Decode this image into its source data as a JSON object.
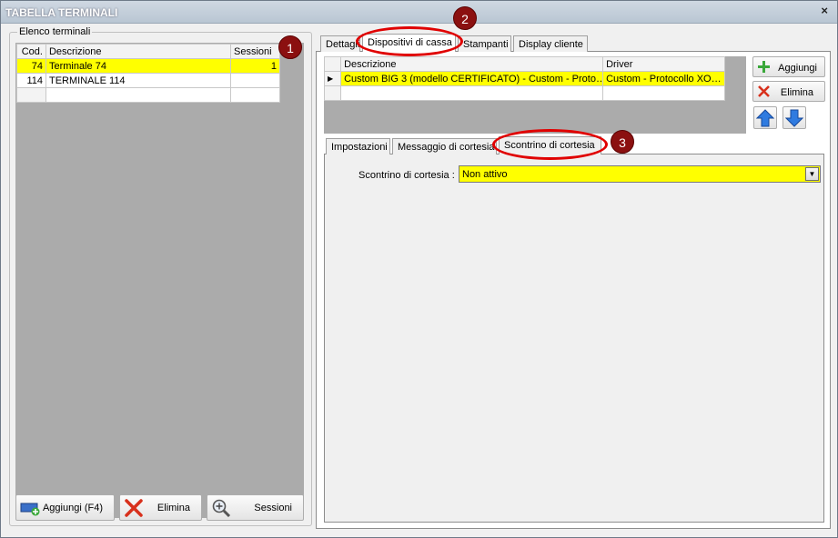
{
  "window": {
    "title": "TABELLA TERMINALI",
    "close_glyph": "×"
  },
  "left": {
    "group_label": "Elenco terminali",
    "columns": [
      "Cod.",
      "Descrizione",
      "Sessioni"
    ],
    "rows": [
      {
        "cod": "74",
        "descrizione": "Terminale 74",
        "sessioni": "1"
      },
      {
        "cod": "114",
        "descrizione": "TERMINALE 114",
        "sessioni": ""
      }
    ],
    "buttons": {
      "add": "Aggiungi (F4)",
      "delete": "Elimina",
      "sessions": "Sessioni"
    }
  },
  "tabs_top": [
    "Dettagli",
    "Dispositivi di cassa",
    "Stampanti",
    "Display cliente"
  ],
  "devices": {
    "columns": [
      "Descrizione",
      "Driver"
    ],
    "rows": [
      {
        "descrizione": "Custom BIG 3 (modello CERTIFICATO) - Custom - Proto…",
        "driver": "Custom - Protocollo XO…"
      }
    ],
    "buttons": {
      "add": "Aggiungi",
      "delete": "Elimina"
    }
  },
  "tabs_sub": [
    "Impostazioni",
    "Messaggio di cortesia",
    "Scontrino di cortesia"
  ],
  "form": {
    "label": "Scontrino di cortesia :",
    "value": "Non attivo"
  },
  "badges": [
    "1",
    "2",
    "3"
  ],
  "colors": {
    "highlight": "#ffff00",
    "annotation_ring": "#e00000",
    "badge": "#8b1010"
  },
  "icons": [
    "close-icon",
    "add-terminal-icon",
    "delete-x-icon",
    "magnifier-plus-icon",
    "plus-icon",
    "arrow-up-icon",
    "arrow-down-icon",
    "row-pointer-icon",
    "chevron-down-icon"
  ]
}
